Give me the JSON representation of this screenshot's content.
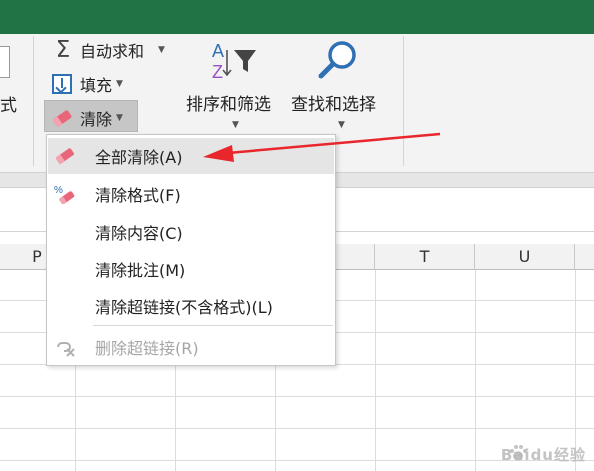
{
  "ribbon": {
    "partial_label": "式",
    "autosum": {
      "icon": "sigma-icon",
      "label": "自动求和"
    },
    "fill": {
      "icon": "fill-down-icon",
      "label": "填充"
    },
    "clear": {
      "icon": "eraser-icon",
      "label": "清除"
    },
    "sort_filter": {
      "icon": "sort-filter-icon",
      "label": "排序和筛选"
    },
    "find_select": {
      "icon": "magnifier-icon",
      "label": "查找和选择"
    }
  },
  "grid": {
    "columns": [
      "P",
      "",
      "",
      "",
      "T",
      "U"
    ]
  },
  "menu": {
    "items": [
      {
        "icon": "eraser-icon",
        "label": "全部清除(A)",
        "highlighted": true,
        "enabled": true
      },
      {
        "icon": "clear-format-icon",
        "label": "清除格式(F)",
        "highlighted": false,
        "enabled": true
      },
      {
        "icon": "",
        "label": "清除内容(C)",
        "highlighted": false,
        "enabled": true
      },
      {
        "icon": "",
        "label": "清除批注(M)",
        "highlighted": false,
        "enabled": true
      },
      {
        "icon": "",
        "label": "清除超链接(不含格式)(L)",
        "highlighted": false,
        "enabled": true
      },
      {
        "icon": "remove-link-icon",
        "label": "删除超链接(R)",
        "highlighted": false,
        "enabled": false
      }
    ]
  },
  "annotation": {
    "color": "#e8262b"
  },
  "watermark": {
    "text": "Baidu经验"
  },
  "colors": {
    "title_bar": "#217346",
    "ribbon": "#f3f3f3",
    "highlight": "#e5e5e5",
    "accent_blue": "#2f6fb4",
    "eraser_pink": "#e8657a"
  }
}
